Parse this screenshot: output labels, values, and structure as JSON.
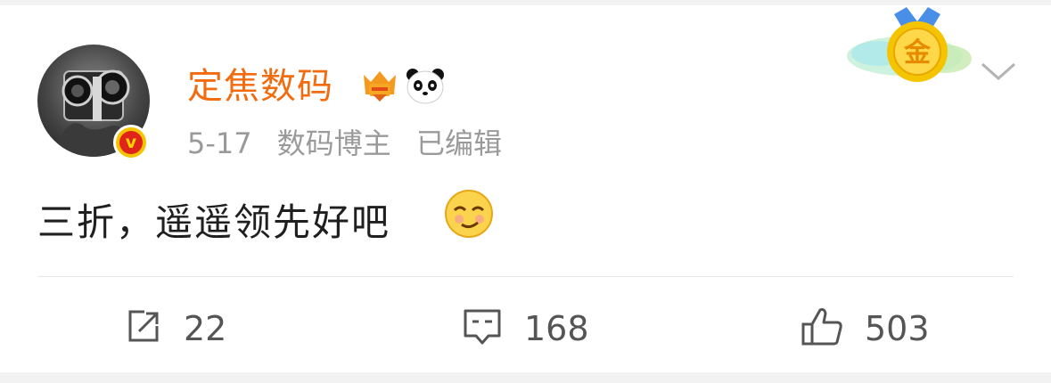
{
  "post": {
    "username": "定焦数码",
    "date": "5-17",
    "category": "数码博主",
    "edited": "已编辑",
    "content": "三折，遥遥领先好吧",
    "badges": [
      "rank-badge-icon",
      "panda-icon"
    ],
    "medal_label": "金"
  },
  "actions": {
    "repost_count": "22",
    "comment_count": "168",
    "like_count": "503"
  },
  "colors": {
    "username": "#f26b0f",
    "meta": "#9a9a9a",
    "verified_bg": "#e0231b",
    "gold": "#f5c400"
  }
}
